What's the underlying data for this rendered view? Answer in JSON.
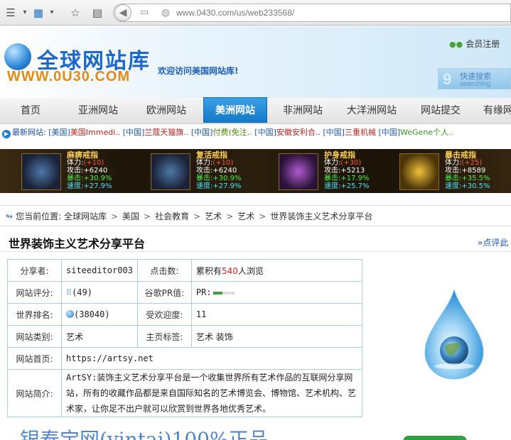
{
  "browser": {
    "url": "www.0430.com/us/web233568/"
  },
  "header": {
    "logo_cn": "全球网站库",
    "logo_en": "WWW.0U30.COM",
    "welcome": "欢迎访问美国网站库!",
    "member_link": "会员注册",
    "search_cn": "快速搜索",
    "search_en": "searching"
  },
  "nav": {
    "items": [
      {
        "label": "首页"
      },
      {
        "label": "亚洲网站"
      },
      {
        "label": "欧洲网站"
      },
      {
        "label": "美洲网站"
      },
      {
        "label": "非洲网站"
      },
      {
        "label": "大洋洲网站"
      },
      {
        "label": "网站提交"
      },
      {
        "label": "有缘网"
      }
    ],
    "active": "美洲网站"
  },
  "ticker": {
    "label": "最新网站:",
    "items": [
      {
        "tag": "[美国]",
        "name": "美国Immedi.."
      },
      {
        "tag": "[中国]",
        "name": "兰蔻天猫旗.."
      },
      {
        "tag": "[中国]",
        "name": "付费(免注.."
      },
      {
        "tag": "[中国]",
        "name": "安徽安利合.."
      },
      {
        "tag": "[中国]",
        "name": "三重机械"
      },
      {
        "tag": "[中国]",
        "name": "WeGene个人.."
      }
    ]
  },
  "banner": {
    "rings": [
      {
        "title": "麻痹戒指",
        "hp": "体力:",
        "lv": "(+10)",
        "atk": "攻击:+6240",
        "crit": "暴击:+30.9%",
        "spd": "速度:+27.9%"
      },
      {
        "title": "复活戒指",
        "hp": "体力:",
        "lv": "(+10)",
        "atk": "攻击:+6240",
        "crit": "暴击:+30.9%",
        "spd": "速度:+27.9%"
      },
      {
        "title": "护身戒指",
        "hp": "体力:",
        "lv": "(+30)",
        "atk": "攻击:+5213",
        "crit": "暴击:+17.9%",
        "spd": "速度:+25.7%"
      },
      {
        "title": "暴击戒指",
        "hp": "体力:",
        "lv": "(+25)",
        "atk": "攻击:+8589",
        "crit": "暴击:+35.5%",
        "spd": "速度:+30.5%"
      }
    ]
  },
  "breadcrumb": {
    "prefix": "您当前位置:",
    "items": [
      "全球网站库",
      "美国",
      "社会教育",
      "艺术",
      "艺术",
      "世界装饰主义艺术分享平台"
    ]
  },
  "page": {
    "title": "世界装饰主义艺术分享平台",
    "comment_link": "»点评此"
  },
  "info": {
    "sharer_label": "分享者:",
    "sharer": "siteeditor003",
    "clicks_label": "点击数:",
    "clicks_prefix": "累积有",
    "clicks_count": "540",
    "clicks_suffix": "人浏览",
    "rating_label": "网站评分:",
    "rating": "(49)",
    "pr_label": "谷歌PR值:",
    "pr_text": "PR:",
    "pr_value": 0.45,
    "rank_label": "世界排名:",
    "rank": "(38040)",
    "popularity_label": "受欢迎度:",
    "popularity": "11",
    "category_label": "网站类别:",
    "category": "艺术",
    "tags_label": "主页标签:",
    "tags": "艺术 装饰",
    "homepage_label": "网站首页:",
    "homepage": "https://artsy.net",
    "intro_label": "网站简介:",
    "intro": "ArtSY:装饰主义艺术分享平台是一个收集世界所有艺术作品的互联网分享网站，所有的收藏作品都是来自国际知名的艺术博览会、博物馆、艺术机构、艺术家，让你足不出户就可以欣赏到世界各地优秀艺术。"
  },
  "bottom": {
    "text": "银泰宝网(yintai)100%正品"
  }
}
